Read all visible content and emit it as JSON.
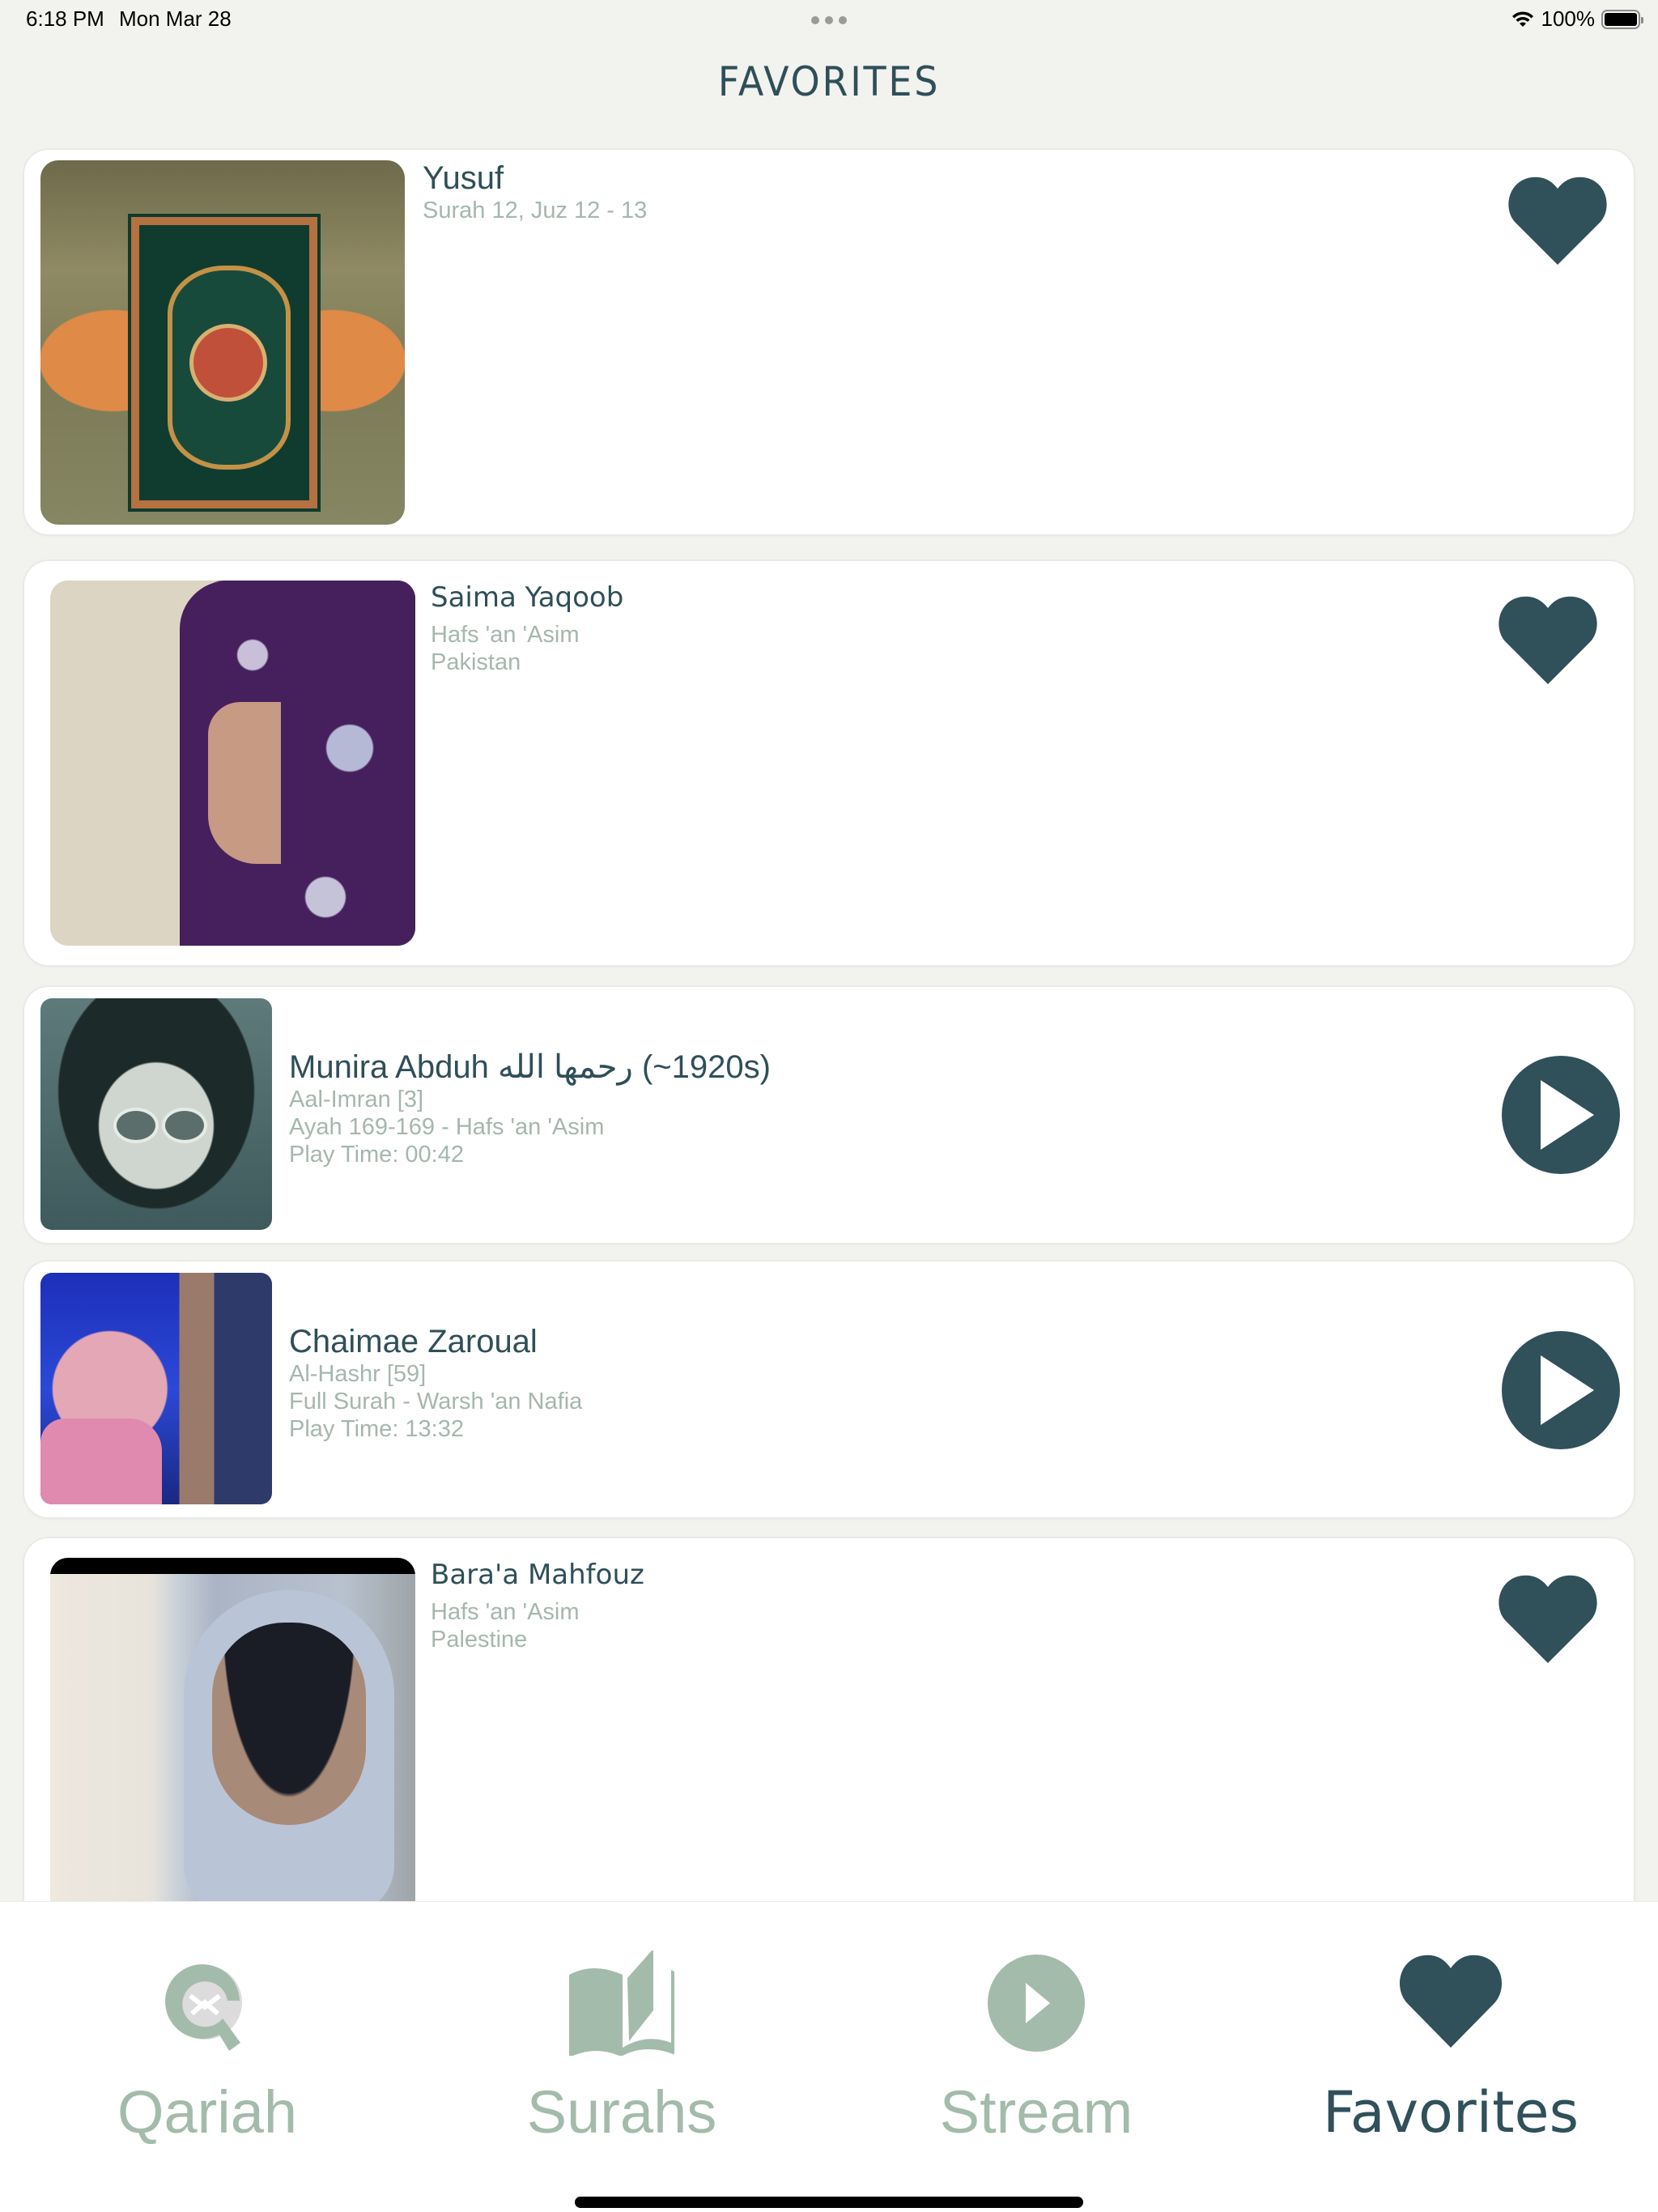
{
  "status_bar": {
    "time": "6:18 PM",
    "date": "Mon Mar 28",
    "battery_percent": "100%",
    "wifi_icon": "wifi-icon",
    "battery_icon": "battery-icon"
  },
  "header": {
    "title": "FAVORITES"
  },
  "colors": {
    "accent": "#30505a",
    "muted_text": "#a6b7ad",
    "inactive_tab": "#a3bbab",
    "background": "#f2f2ef",
    "card": "#ffffff"
  },
  "favorites": [
    {
      "type": "surah",
      "title": "Yusuf",
      "lines": [
        "Surah 12, Juz 12 - 13"
      ],
      "action": "heart-icon",
      "image": "quran-book-photo"
    },
    {
      "type": "reciter",
      "title": "Saima Yaqoob",
      "lines": [
        "Hafs 'an 'Asim",
        "Pakistan"
      ],
      "action": "heart-icon",
      "image": "reciter-profile-photo"
    },
    {
      "type": "recitation",
      "title": "Munira Abduh رحمها الله (~1920s)",
      "lines": [
        "Aal-Imran  [3]",
        "Ayah 169-169 - Hafs 'an 'Asim",
        "Play Time: 00:42"
      ],
      "action": "play-icon",
      "image": "reciter-portrait"
    },
    {
      "type": "recitation",
      "title": "Chaimae Zaroual",
      "lines": [
        "Al-Hashr  [59]",
        "Full Surah - Warsh 'an Nafia",
        "Play Time: 13:32"
      ],
      "action": "play-icon",
      "image": "reciter-stage-photo"
    },
    {
      "type": "reciter",
      "title": "Bara'a Mahfouz",
      "lines": [
        "Hafs 'an 'Asim",
        "Palestine"
      ],
      "action": "heart-icon",
      "image": "reciter-photo"
    }
  ],
  "tab_bar": {
    "tabs": [
      {
        "label": "Qariah",
        "icon": "qariah-logo-icon",
        "active": false
      },
      {
        "label": "Surahs",
        "icon": "open-book-icon",
        "active": false
      },
      {
        "label": "Stream",
        "icon": "play-circle-icon",
        "active": false
      },
      {
        "label": "Favorites",
        "icon": "heart-icon",
        "active": true
      }
    ]
  }
}
